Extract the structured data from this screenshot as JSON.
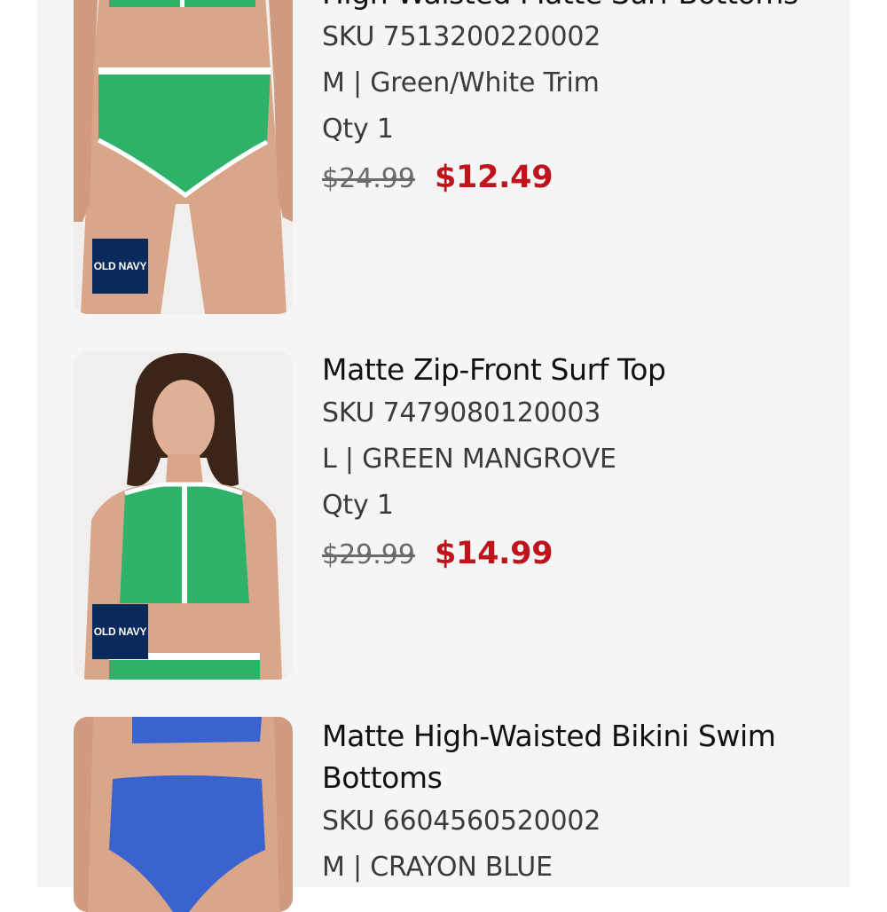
{
  "cart": {
    "items": [
      {
        "name": "High-Waisted Matte Surf Bottoms",
        "sku": "SKU 7513200220002",
        "variant": "M | Green/White Trim",
        "qty": "Qty 1",
        "original_price": "$24.99",
        "sale_price": "$12.49",
        "brand_badge": "OLD NAVY",
        "image": "green-high-waisted-bottoms-photo"
      },
      {
        "name": "Matte Zip-Front Surf Top",
        "sku": "SKU 7479080120003",
        "variant": "L | GREEN MANGROVE",
        "qty": "Qty 1",
        "original_price": "$29.99",
        "sale_price": "$14.99",
        "brand_badge": "OLD NAVY",
        "image": "green-zip-front-surf-top-photo"
      },
      {
        "name": "Matte High-Waisted Bikini Swim Bottoms",
        "sku": "SKU 6604560520002",
        "variant": "M | CRAYON BLUE",
        "image": "blue-high-waisted-bikini-bottoms-photo"
      }
    ]
  },
  "colors": {
    "sale_price": "#c0141c",
    "badge_background": "#0b2a5c",
    "panel_background": "#f5f5f5"
  }
}
